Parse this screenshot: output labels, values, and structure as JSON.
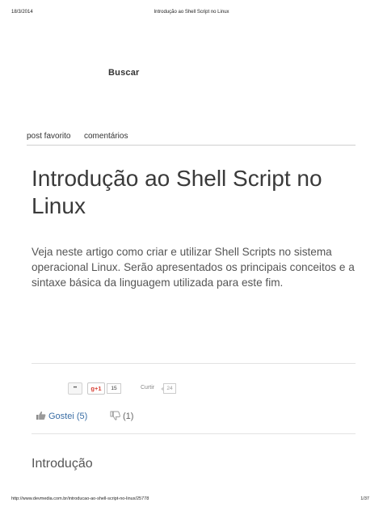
{
  "print_header": {
    "date": "18/3/2014",
    "title": "Introdução ao Shell Script no Linux"
  },
  "search": {
    "label": "Buscar"
  },
  "tabs": [
    {
      "label": "post favorito"
    },
    {
      "label": "comentários"
    }
  ],
  "article": {
    "title": "Introdução ao Shell Script no Linux",
    "lead": "Veja neste artigo como criar e utilizar Shell Scripts no sistema operacional Linux. Serão apresentados os principais conceitos e a sintaxe básica da linguagem utilizada para este fim."
  },
  "share": {
    "gplus_label": "g+1",
    "gplus_count": "15",
    "like_label": "Curtir",
    "like_count": "24"
  },
  "votes": {
    "up_label": "Gostei (5)",
    "down_label": "(1)"
  },
  "section": {
    "heading": "Introdução"
  },
  "print_footer": {
    "url": "http://www.devmedia.com.br/introducao-ao-shell-script-no-linux/25778",
    "page": "1/37"
  },
  "colors": {
    "vote_up": "#3a6ea5",
    "gplus": "#d73d32",
    "divider": "#e2e2e2"
  },
  "icons": [
    "thumbs-up-icon",
    "thumbs-down-icon",
    "share-icon"
  ]
}
